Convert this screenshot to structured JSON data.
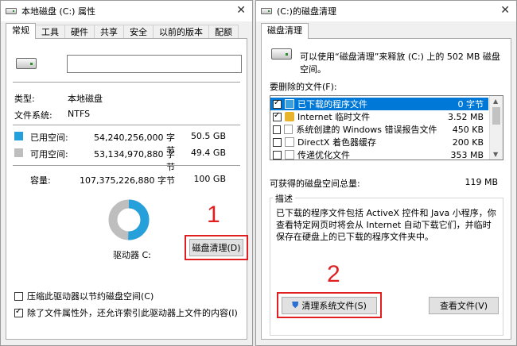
{
  "left_window": {
    "title": "本地磁盘 (C:) 属性",
    "tabs": [
      "常规",
      "工具",
      "硬件",
      "共享",
      "安全",
      "以前的版本",
      "配额"
    ],
    "type_label": "类型:",
    "type_value": "本地磁盘",
    "fs_label": "文件系统:",
    "fs_value": "NTFS",
    "used_label": "已用空间:",
    "used_bytes": "54,240,256,000 字节",
    "used_size": "50.5 GB",
    "free_label": "可用空间:",
    "free_bytes": "53,134,970,880 字节",
    "free_size": "49.4 GB",
    "capacity_label": "容量:",
    "capacity_bytes": "107,375,226,880 字节",
    "capacity_size": "100 GB",
    "drive_label": "驱动器 C:",
    "cleanup_button": "磁盘清理(D)",
    "step1": "1",
    "compress_option": "压缩此驱动器以节约磁盘空间(C)",
    "index_option": "除了文件属性外，还允许索引此驱动器上文件的内容(I)",
    "used_color": "#26a0da",
    "free_color": "#bebebe"
  },
  "right_window": {
    "title": "(C:)的磁盘清理",
    "tab": "磁盘清理",
    "intro": "可以使用“磁盘清理”来释放 (C:) 上的 502 MB 磁盘空间。",
    "delete_label": "要删除的文件(F):",
    "files": [
      {
        "name": "已下载的程序文件",
        "size": "0 字节",
        "checked": true,
        "selected": true
      },
      {
        "name": "Internet 临时文件",
        "size": "3.52 MB",
        "checked": true,
        "selected": false
      },
      {
        "name": "系统创建的 Windows 错误报告文件",
        "size": "450 KB",
        "checked": false,
        "selected": false
      },
      {
        "name": "DirectX 着色器缓存",
        "size": "200 KB",
        "checked": false,
        "selected": false
      },
      {
        "name": "传递优化文件",
        "size": "353 MB",
        "checked": false,
        "selected": false
      }
    ],
    "total_label": "可获得的磁盘空间总量:",
    "total_value": "119 MB",
    "desc_label": "描述",
    "desc_text": "已下载的程序文件包括 ActiveX 控件和 Java 小程序，你查看特定网页时将会从 Internet 自动下载它们，并临时保存在硬盘上的已下载的程序文件夹中。",
    "cleanup_system_button": "清理系统文件(S)",
    "view_files_button": "查看文件(V)",
    "step2": "2"
  }
}
